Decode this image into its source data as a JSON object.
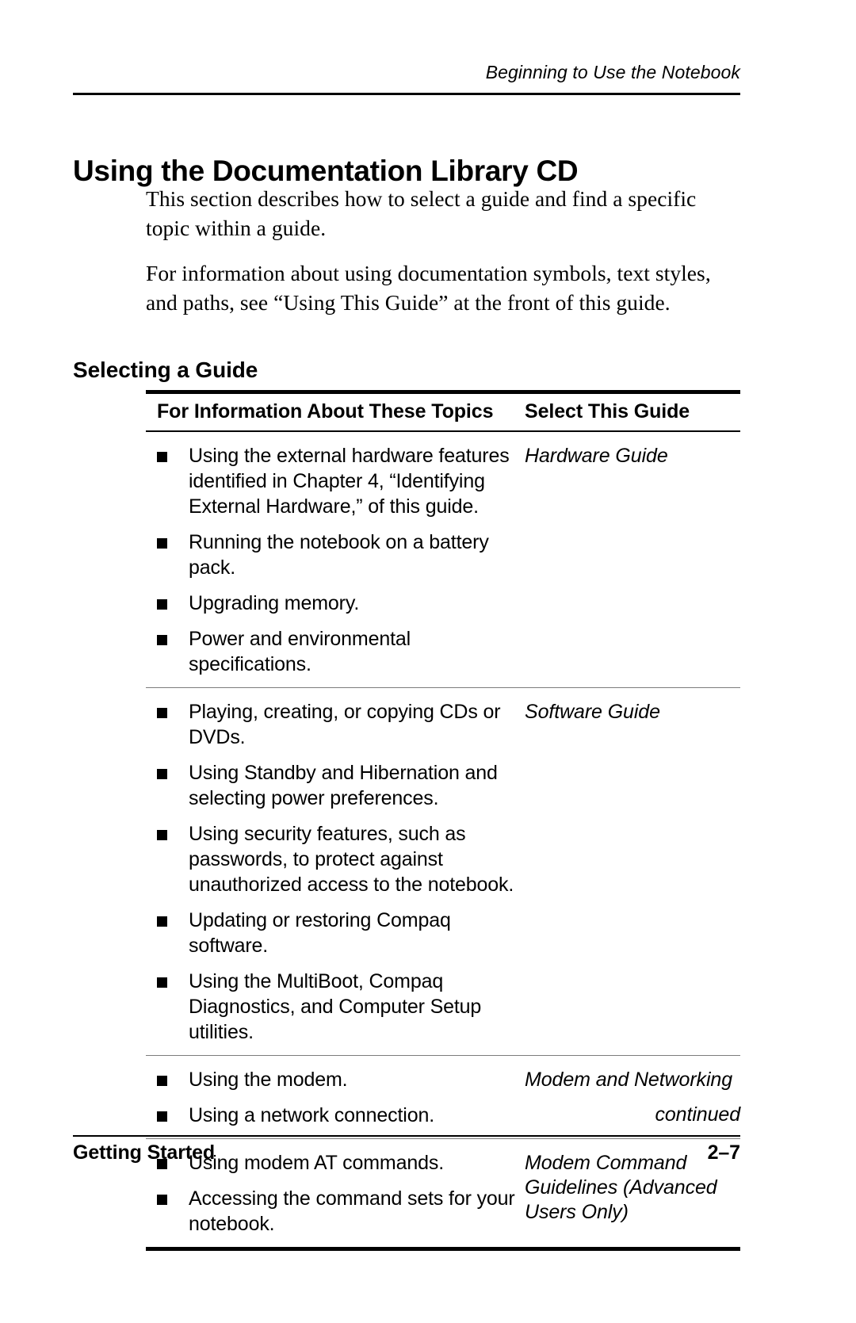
{
  "header": {
    "running_head": "Beginning to Use the Notebook"
  },
  "chapter": {
    "title": "Using the Documentation Library CD",
    "intro_paragraphs": [
      "This section describes how to select a guide and find a specific topic within a guide.",
      "For information about using documentation symbols, text styles, and paths, see “Using This Guide” at the front of this guide."
    ]
  },
  "section": {
    "heading": "Selecting a Guide"
  },
  "table": {
    "columns": {
      "topics": "For Information About These Topics",
      "guide": "Select This Guide"
    },
    "rows": [
      {
        "guide": "Hardware Guide",
        "topics": [
          "Using the external hardware features identified in Chapter 4, “Identifying External Hardware,” of this guide.",
          "Running the notebook on a battery pack.",
          "Upgrading memory.",
          "Power and environmental specifications."
        ]
      },
      {
        "guide": "Software Guide",
        "topics": [
          "Playing, creating, or copying CDs or DVDs.",
          "Using Standby and Hibernation and selecting power preferences.",
          "Using security features, such as passwords, to protect against unauthorized access to the notebook.",
          "Updating or restoring Compaq software.",
          "Using the MultiBoot, Compaq Diagnostics, and Computer Setup utilities."
        ]
      },
      {
        "guide": "Modem and Networking",
        "topics": [
          "Using the modem.",
          "Using a network connection."
        ]
      },
      {
        "guide": "Modem Command Guidelines (Advanced Users Only)",
        "topics": [
          "Using modem AT commands.",
          "Accessing the command sets for your notebook."
        ]
      }
    ],
    "continued_label": "continued"
  },
  "footer": {
    "document_title": "Getting Started",
    "page_number": "2–7"
  }
}
